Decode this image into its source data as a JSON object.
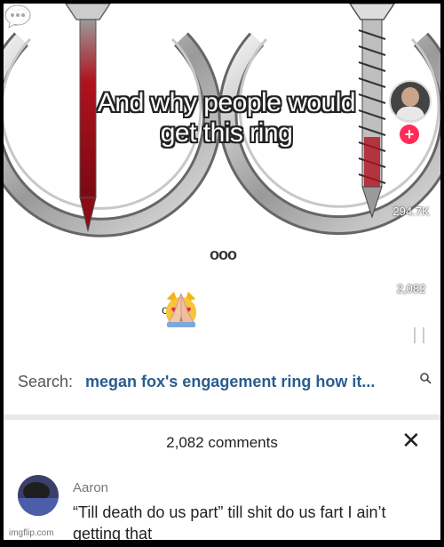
{
  "video": {
    "caption_line1": "And why people would",
    "caption_line2": "get this ring",
    "likes": "294.7K",
    "comments": "2,082",
    "dots": "ooo",
    "emoji_tail": "o",
    "icons": [
      "nail-ring",
      "screw-ring",
      "heart-icon",
      "comment-icon",
      "plus-icon",
      "heart-eyes-cat",
      "folded-hands"
    ]
  },
  "search": {
    "label": "Search:",
    "query": "megan fox's engagement ring how it..."
  },
  "comments_sheet": {
    "title": "2,082 comments",
    "close_glyph": "✕",
    "comment": {
      "author": "Aaron",
      "text": "“Till death do us part” till shit do us fart I ain’t getting that"
    }
  },
  "watermark": "imgflip.com",
  "colors": {
    "search_query": "#2a5d8f",
    "follow_plus": "#ff2c55",
    "blood": "#b0121e"
  }
}
